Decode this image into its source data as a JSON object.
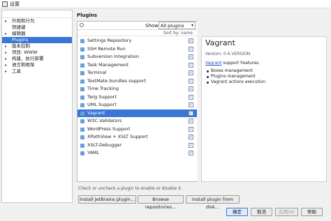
{
  "window": {
    "title": "设置"
  },
  "tree": {
    "items": [
      {
        "label": "外观和行为",
        "arrow": "▸",
        "child": false,
        "selected": false
      },
      {
        "label": "快捷键",
        "arrow": "",
        "child": true,
        "selected": false
      },
      {
        "label": "编辑器",
        "arrow": "▸",
        "child": false,
        "selected": false
      },
      {
        "label": "Plugins",
        "arrow": "",
        "child": true,
        "selected": true
      },
      {
        "label": "版本控制",
        "arrow": "▸",
        "child": false,
        "selected": false
      },
      {
        "label": "项目: WWW",
        "arrow": "▸",
        "child": false,
        "selected": false
      },
      {
        "label": "构建、执行部署",
        "arrow": "▸",
        "child": false,
        "selected": false
      },
      {
        "label": "语言和框架",
        "arrow": "▸",
        "child": false,
        "selected": false
      },
      {
        "label": "工具",
        "arrow": "▸",
        "child": false,
        "selected": false
      }
    ]
  },
  "plugins": {
    "title": "Plugins",
    "show_label": "Show:",
    "show_value": "All plugins",
    "sort_label": "Sort by: name",
    "rows": [
      {
        "name": "Settings Repository",
        "checked": true,
        "selected": false
      },
      {
        "name": "SSH Remote Run",
        "checked": true,
        "selected": false
      },
      {
        "name": "Subversion Integration",
        "checked": true,
        "selected": false
      },
      {
        "name": "Task Management",
        "checked": true,
        "selected": false
      },
      {
        "name": "Terminal",
        "checked": true,
        "selected": false
      },
      {
        "name": "TextMate bundles support",
        "checked": true,
        "selected": false
      },
      {
        "name": "Time Tracking",
        "checked": true,
        "selected": false
      },
      {
        "name": "Twig Support",
        "checked": true,
        "selected": false
      },
      {
        "name": "UML Support",
        "checked": true,
        "selected": false
      },
      {
        "name": "Vagrant",
        "checked": true,
        "selected": true
      },
      {
        "name": "W3C Validators",
        "checked": true,
        "selected": false
      },
      {
        "name": "WordPress Support",
        "checked": true,
        "selected": false
      },
      {
        "name": "XPathView + XSLT Support",
        "checked": true,
        "selected": false
      },
      {
        "name": "XSLT-Debugger",
        "checked": true,
        "selected": false
      },
      {
        "name": "YAML",
        "checked": true,
        "selected": false
      }
    ],
    "hint": "Check or uncheck a plugin to enable or disable it.",
    "buttons": {
      "install_jetbrains": "Install JetBrains plugin...",
      "browse_repos": "Browse repositories...",
      "install_disk": "Install plugin from disk..."
    }
  },
  "detail": {
    "title": "Vagrant",
    "version": "Version: 0.6.VERSION",
    "desc_link": "Vagrant",
    "desc_text": " support Features:",
    "features": [
      "Boxes management",
      "Plugins management",
      "Vagrant actions execution"
    ]
  },
  "footer": {
    "ok": "确定",
    "cancel": "取消",
    "apply": "应用(A)",
    "help": "帮助"
  },
  "colors": {
    "selection": "#3a76d8",
    "link": "#1a4fcf"
  }
}
